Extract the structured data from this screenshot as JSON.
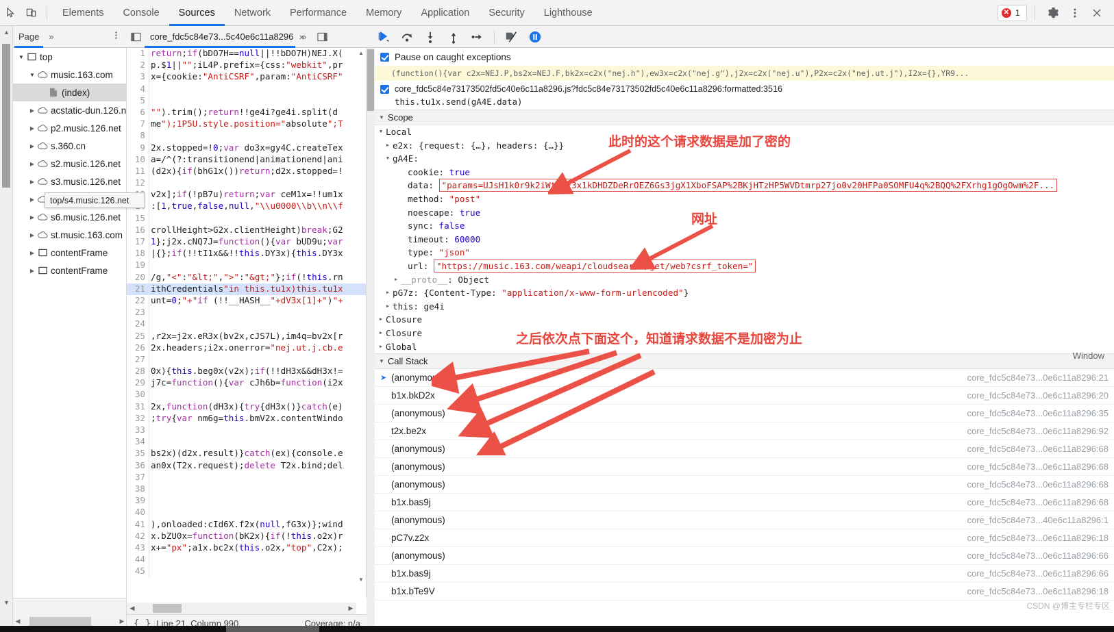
{
  "topbar": {
    "inspect_icon": "inspect-cursor-icon",
    "device_icon": "device-toolbar-icon",
    "tabs": [
      {
        "label": "Elements",
        "active": false
      },
      {
        "label": "Console",
        "active": false
      },
      {
        "label": "Sources",
        "active": true
      },
      {
        "label": "Network",
        "active": false
      },
      {
        "label": "Performance",
        "active": false
      },
      {
        "label": "Memory",
        "active": false
      },
      {
        "label": "Application",
        "active": false
      },
      {
        "label": "Security",
        "active": false
      },
      {
        "label": "Lighthouse",
        "active": false
      }
    ],
    "error_count": "1",
    "settings_icon": "gear-icon",
    "more_icon": "three-dots-vertical-icon",
    "close_icon": "close-x-icon"
  },
  "navigator": {
    "tab_label": "Page",
    "more_tabs": "»",
    "menu_icon": "three-dots-vertical-icon",
    "tree": [
      {
        "label": "top",
        "icon": "frame-icon",
        "depth": 0,
        "twisty": "open",
        "selected": false
      },
      {
        "label": "music.163.com",
        "icon": "cloud-icon",
        "depth": 1,
        "twisty": "open",
        "selected": false
      },
      {
        "label": "(index)",
        "icon": "document-icon",
        "depth": 2,
        "twisty": "none",
        "selected": true
      },
      {
        "label": "acstatic-dun.126.net",
        "icon": "cloud-icon",
        "depth": 1,
        "twisty": "closed",
        "selected": false
      },
      {
        "label": "p2.music.126.net",
        "icon": "cloud-icon",
        "depth": 1,
        "twisty": "closed",
        "selected": false
      },
      {
        "label": "s.360.cn",
        "icon": "cloud-icon",
        "depth": 1,
        "twisty": "closed",
        "selected": false
      },
      {
        "label": "s2.music.126.net",
        "icon": "cloud-icon",
        "depth": 1,
        "twisty": "closed",
        "selected": false
      },
      {
        "label": "s3.music.126.net",
        "icon": "cloud-icon",
        "depth": 1,
        "twisty": "closed",
        "selected": false
      },
      {
        "label": "s4.music.126.net",
        "icon": "cloud-icon",
        "depth": 1,
        "twisty": "closed",
        "selected": false
      },
      {
        "label": "s6.music.126.net",
        "icon": "cloud-icon",
        "depth": 1,
        "twisty": "closed",
        "selected": false
      },
      {
        "label": "st.music.163.com",
        "icon": "cloud-icon",
        "depth": 1,
        "twisty": "closed",
        "selected": false
      },
      {
        "label": "contentFrame",
        "icon": "frame-icon",
        "depth": 1,
        "twisty": "closed",
        "selected": false
      },
      {
        "label": "contentFrame",
        "icon": "frame-icon",
        "depth": 1,
        "twisty": "closed",
        "selected": false
      }
    ],
    "tooltip": "top/s4.music.126.net"
  },
  "editor": {
    "tab_title": "core_fdc5c84e73...5c40e6c11a8296",
    "tab_close": "×",
    "more_tabs": "»",
    "show_nav_icon": "show-navigator-icon",
    "show_dbg_icon": "show-debugger-icon",
    "lines": [
      {
        "n": "1",
        "t": "return;if(bDO7H==null||!!bDO7H)NEJ.X(",
        "hl": false
      },
      {
        "n": "2",
        "t": "p.$1||\"\";iL4P.prefix={css:\"webkit\",pr",
        "hl": false
      },
      {
        "n": "3",
        "t": "x={cookie:\"AntiCSRF\",param:\"AntiCSRF\"",
        "hl": false
      },
      {
        "n": "4",
        "t": "",
        "hl": false
      },
      {
        "n": "5",
        "t": "",
        "hl": false
      },
      {
        "n": "6",
        "t": "\"\").trim();return!!ge4i?ge4i.split(d",
        "hl": false
      },
      {
        "n": "7",
        "t": "me\");1P5U.style.position=\"absolute\";T",
        "hl": false
      },
      {
        "n": "8",
        "t": "",
        "hl": false
      },
      {
        "n": "9",
        "t": "2x.stopped=!0;var do3x=gy4C.createTex",
        "hl": false
      },
      {
        "n": "10",
        "t": "a=/^(?:transitionend|animationend|ani",
        "hl": false
      },
      {
        "n": "11",
        "t": "(d2x){if(bhG1x())return;d2x.stopped=!",
        "hl": false
      },
      {
        "n": "12",
        "t": "",
        "hl": false
      },
      {
        "n": "13",
        "t": "v2x];if(!pB7u)return;var ceM1x=!!um1x",
        "hl": false
      },
      {
        "n": "14",
        "t": ":[1,true,false,null,\"\\\\u0000\\\\b\\\\n\\\\f",
        "hl": false
      },
      {
        "n": "15",
        "t": "",
        "hl": false
      },
      {
        "n": "16",
        "t": "crollHeight>G2x.clientHeight)break;G2",
        "hl": false
      },
      {
        "n": "17",
        "t": "1};j2x.cNQ7J=function(){var bUD9u;var",
        "hl": false
      },
      {
        "n": "18",
        "t": "|{};if(!!tI1x&&!!this.DY3x){this.DY3x",
        "hl": false
      },
      {
        "n": "19",
        "t": "",
        "hl": false
      },
      {
        "n": "20",
        "t": "/g,\"<\":\"&lt;\",\">\":\"&gt;\"};if(!this.rn",
        "hl": false
      },
      {
        "n": "21",
        "t": "ithCredentials\"in this.tu1x)this.tu1x",
        "hl": true
      },
      {
        "n": "22",
        "t": "unt=0;\"+\"if (!!__HASH__\"+dV3x[1]+\")\"+",
        "hl": false
      },
      {
        "n": "23",
        "t": "",
        "hl": false
      },
      {
        "n": "24",
        "t": "",
        "hl": false
      },
      {
        "n": "25",
        "t": ",r2x=j2x.eR3x(bv2x,cJS7L),im4q=bv2x[r",
        "hl": false
      },
      {
        "n": "26",
        "t": "2x.headers;i2x.onerror=\"nej.ut.j.cb.e",
        "hl": false
      },
      {
        "n": "27",
        "t": "",
        "hl": false
      },
      {
        "n": "28",
        "t": "0x){this.beg0x(v2x);if(!!dH3x&&dH3x!=",
        "hl": false
      },
      {
        "n": "29",
        "t": "j7c=function(){var cJh6b=function(i2x",
        "hl": false
      },
      {
        "n": "30",
        "t": "",
        "hl": false
      },
      {
        "n": "31",
        "t": "2x,function(dH3x){try{dH3x()}catch(e)",
        "hl": false
      },
      {
        "n": "32",
        "t": ";try{var nm6g=this.bmV2x.contentWindo",
        "hl": false
      },
      {
        "n": "33",
        "t": "",
        "hl": false
      },
      {
        "n": "34",
        "t": "",
        "hl": false
      },
      {
        "n": "35",
        "t": "bs2x)(d2x.result)}catch(ex){console.e",
        "hl": false
      },
      {
        "n": "36",
        "t": "an0x(T2x.request);delete T2x.bind;del",
        "hl": false
      },
      {
        "n": "37",
        "t": "",
        "hl": false
      },
      {
        "n": "38",
        "t": "",
        "hl": false
      },
      {
        "n": "39",
        "t": "",
        "hl": false
      },
      {
        "n": "40",
        "t": "",
        "hl": false
      },
      {
        "n": "41",
        "t": "),onloaded:cId6X.f2x(null,fG3x)};wind",
        "hl": false
      },
      {
        "n": "42",
        "t": "x.bZU0x=function(bK2x){if(!this.o2x)r",
        "hl": false
      },
      {
        "n": "43",
        "t": "x+=\"px\";a1x.bc2x(this.o2x,\"top\",C2x);",
        "hl": false
      },
      {
        "n": "44",
        "t": "",
        "hl": false
      },
      {
        "n": "45",
        "t": "",
        "hl": false
      }
    ]
  },
  "statusbar": {
    "format_icon": "pretty-print-braces-icon",
    "position": "Line 21, Column 990",
    "coverage": "Coverage: n/a"
  },
  "debugger_toolbar": {
    "resume": "resume-script-icon",
    "step_over": "step-over-icon",
    "step_into": "step-into-icon",
    "step_out": "step-out-icon",
    "step": "step-icon",
    "deactivate_breakpoints": "deactivate-breakpoints-icon",
    "pause_on_exceptions": "pause-on-exceptions-icon"
  },
  "breakpoints": {
    "pause_on_caught_label": "Pause on caught exceptions",
    "pause_on_caught_checked": true,
    "snippet": "(function(){var c2x=NEJ.P,bs2x=NEJ.F,bk2x=c2x(\"nej.h\"),ew3x=c2x(\"nej.g\"),j2x=c2x(\"nej.u\"),P2x=c2x(\"nej.ut.j\"),I2x={},YR9...",
    "items": [
      {
        "checked": true,
        "file": "core_fdc5c84e73173502fd5c40e6c11a8296.js?fdc5c84e73173502fd5c40e6c11a8296:formatted:3516",
        "code": "this.tu1x.send(gA4E.data)"
      }
    ]
  },
  "scope": {
    "title": "Scope",
    "groups": [
      {
        "name": "Local",
        "expanded": true
      },
      {
        "name": "Closure",
        "expanded": false
      },
      {
        "name": "Closure",
        "expanded": false
      },
      {
        "name": "Global",
        "expanded": false,
        "right_label": "Window"
      }
    ],
    "local_vars": [
      {
        "twisty": "closed",
        "name": "e2x",
        "value": "{request: {…}, headers: {…}}",
        "kind": "object"
      },
      {
        "twisty": "open",
        "name": "gA4E",
        "value": "",
        "kind": "object"
      }
    ],
    "gA4E_props": [
      {
        "name": "cookie",
        "value": "true",
        "kind": "bool",
        "boxed": false
      },
      {
        "name": "data",
        "value": "\"params=UJsH1k0r9k2iWt%2F3x1kDHDZDeRrOEZ6Gs3jgX1XboFSAP%2BKjHTzHP5WVDtmrp27jo0v20HFPa0SOMFU4q%2BQQ%2FXrhg1gOgOwm%2F...",
        "kind": "str",
        "boxed": true
      },
      {
        "name": "method",
        "value": "\"post\"",
        "kind": "str",
        "boxed": false
      },
      {
        "name": "noescape",
        "value": "true",
        "kind": "bool",
        "boxed": false
      },
      {
        "name": "sync",
        "value": "false",
        "kind": "bool",
        "boxed": false
      },
      {
        "name": "timeout",
        "value": "60000",
        "kind": "num",
        "boxed": false
      },
      {
        "name": "type",
        "value": "\"json\"",
        "kind": "str",
        "boxed": false
      },
      {
        "name": "url",
        "value": "\"https://music.163.com/weapi/cloudsearch/get/web?csrf_token=\"",
        "kind": "str",
        "boxed": true
      }
    ],
    "proto_row": {
      "twisty": "closed",
      "name": "__proto__",
      "value": "Object"
    },
    "other_local": [
      {
        "twisty": "closed",
        "name": "pG7z",
        "value": "{Content-Type: \"application/x-www-form-urlencoded\"}",
        "kind": "object"
      },
      {
        "twisty": "closed",
        "name": "this",
        "value": "ge4i",
        "kind": "plain"
      }
    ]
  },
  "call_stack": {
    "title": "Call Stack",
    "rows": [
      {
        "current": true,
        "name": "(anonymous)",
        "location": "core_fdc5c84e73...0e6c11a8296:21"
      },
      {
        "current": false,
        "name": "b1x.bkD2x",
        "location": "core_fdc5c84e73...0e6c11a8296:20"
      },
      {
        "current": false,
        "name": "(anonymous)",
        "location": "core_fdc5c84e73...0e6c11a8296:35"
      },
      {
        "current": false,
        "name": "t2x.be2x",
        "location": "core_fdc5c84e73...0e6c11a8296:92"
      },
      {
        "current": false,
        "name": "(anonymous)",
        "location": "core_fdc5c84e73...0e6c11a8296:68"
      },
      {
        "current": false,
        "name": "(anonymous)",
        "location": "core_fdc5c84e73...0e6c11a8296:68"
      },
      {
        "current": false,
        "name": "(anonymous)",
        "location": "core_fdc5c84e73...0e6c11a8296:68"
      },
      {
        "current": false,
        "name": "b1x.bas9j",
        "location": "core_fdc5c84e73...0e6c11a8296:68"
      },
      {
        "current": false,
        "name": "(anonymous)",
        "location": "core_fdc5c84e73...40e6c11a8296:1"
      },
      {
        "current": false,
        "name": "pC7v.z2x",
        "location": "core_fdc5c84e73...0e6c11a8296:18"
      },
      {
        "current": false,
        "name": "(anonymous)",
        "location": "core_fdc5c84e73...0e6c11a8296:66"
      },
      {
        "current": false,
        "name": "b1x.bas9j",
        "location": "core_fdc5c84e73...0e6c11a8296:66"
      },
      {
        "current": false,
        "name": "b1x.bTe9V",
        "location": "core_fdc5c84e73...0e6c11a8296:18"
      }
    ]
  },
  "annotations": [
    {
      "id": "anno-encrypted",
      "text": "此时的这个请求数据是加了密的"
    },
    {
      "id": "anno-url",
      "text": "网址"
    },
    {
      "id": "anno-clicknext",
      "text": "之后依次点下面这个，知道请求数据不是加密为止"
    }
  ],
  "watermark": "CSDN @博主专栏专区",
  "colors": {
    "accent": "#1a73e8",
    "annotation_red": "#e8453c",
    "highlight_line": "#d4e2fb",
    "breakpoint_yellow": "#fdf9d8",
    "error_red": "#e22c2c"
  }
}
